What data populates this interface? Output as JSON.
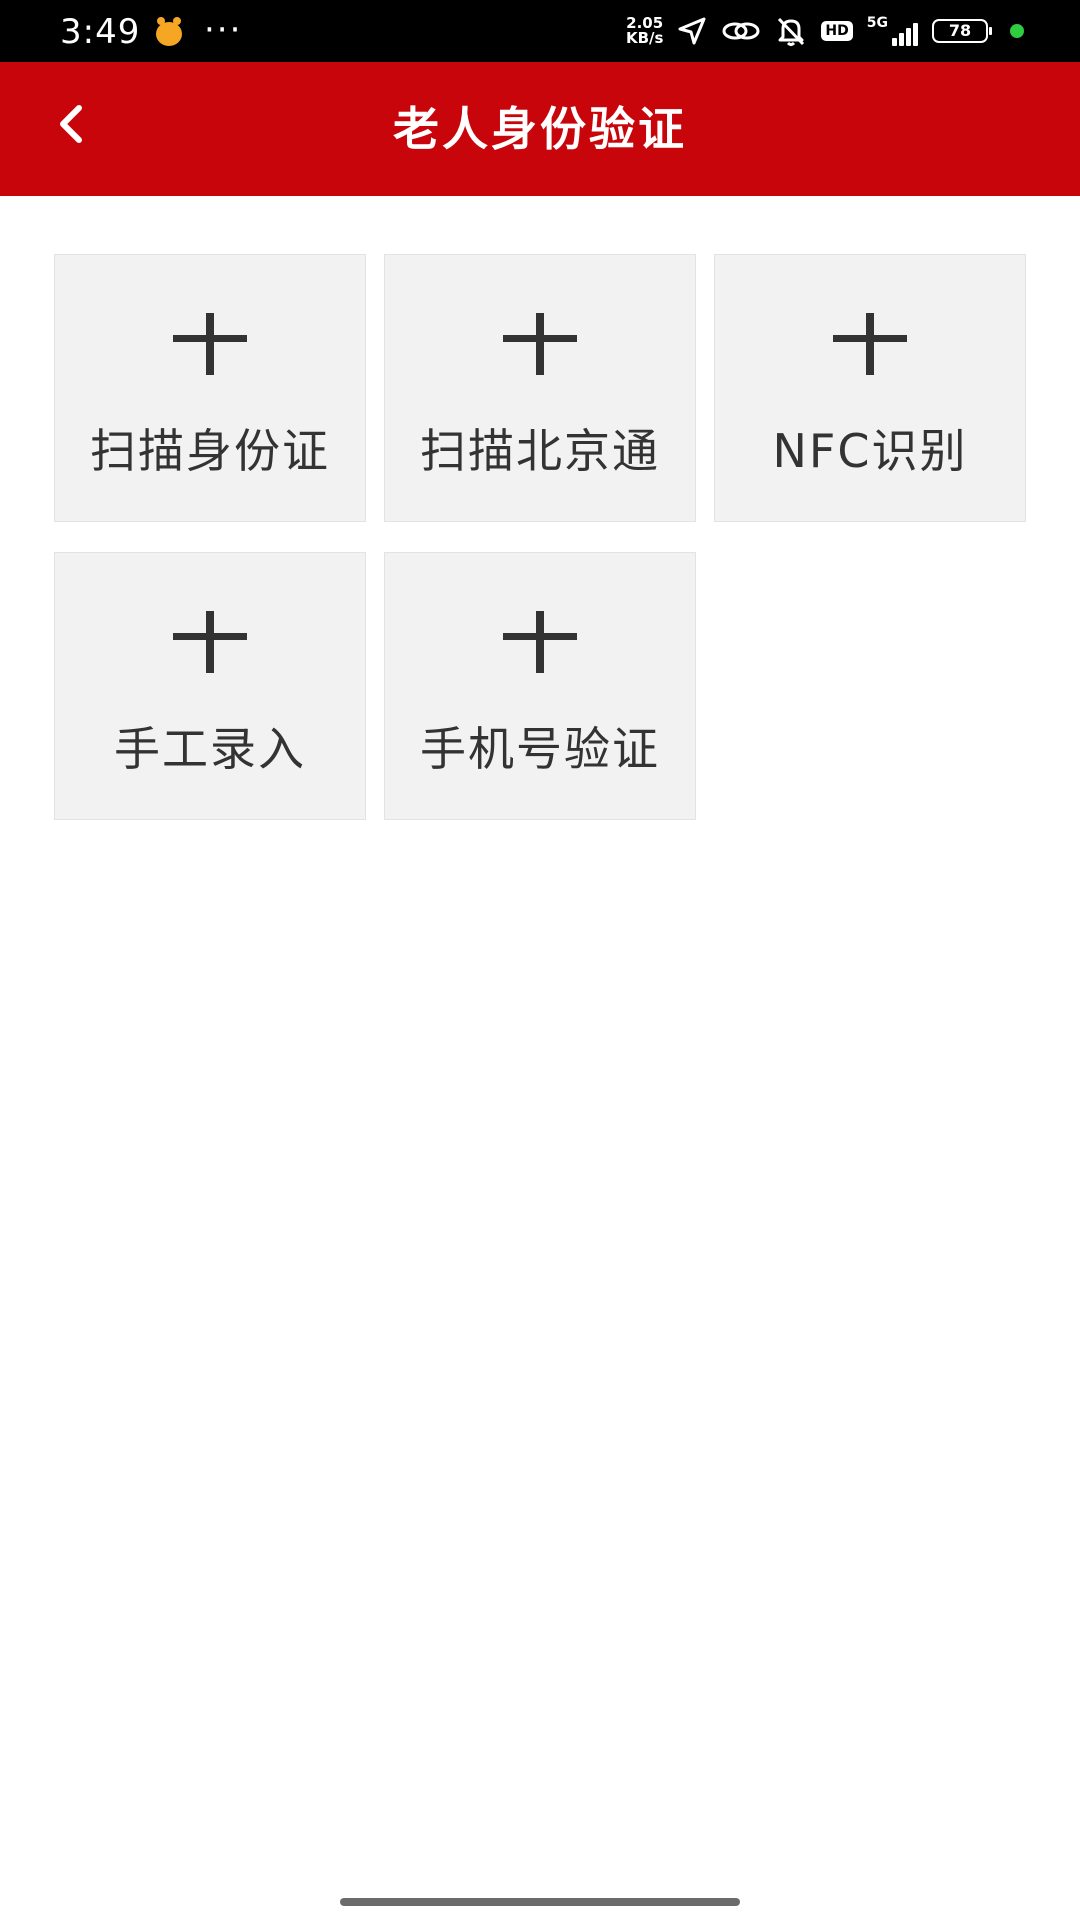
{
  "status_bar": {
    "time": "3:49",
    "more": "···",
    "net_speed_value": "2.05",
    "net_speed_unit": "KB/s",
    "network": "5G",
    "hd": "HD",
    "battery": "78",
    "icons": [
      "location-arrow-icon",
      "link-icon",
      "mute-bell-icon",
      "hd-icon",
      "signal-icon",
      "battery-icon"
    ],
    "dot_color": "#2ecc40"
  },
  "header": {
    "title": "老人身份验证",
    "back_icon": "chevron-left-icon",
    "background_color": "#c8050b"
  },
  "options": [
    {
      "label": "扫描身份证",
      "icon": "plus-icon"
    },
    {
      "label": "扫描北京通",
      "icon": "plus-icon"
    },
    {
      "label": "NFC识别",
      "icon": "plus-icon"
    },
    {
      "label": "手工录入",
      "icon": "plus-icon"
    },
    {
      "label": "手机号验证",
      "icon": "plus-icon"
    }
  ]
}
